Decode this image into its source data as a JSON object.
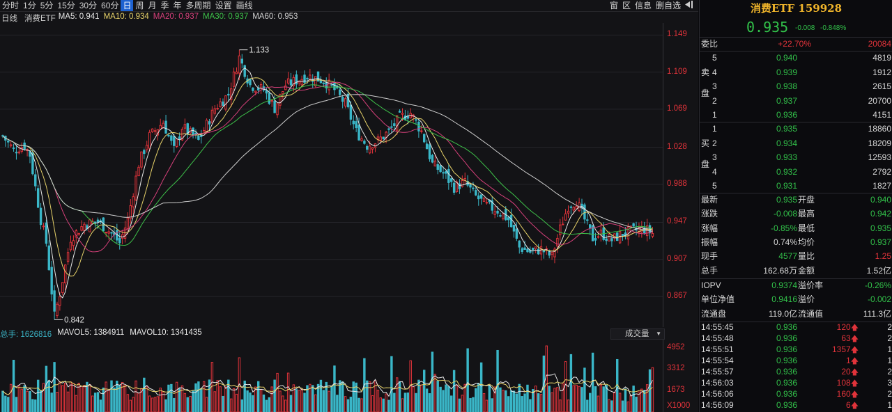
{
  "toolbar": {
    "periods": [
      "分时",
      "1分",
      "5分",
      "15分",
      "30分",
      "60分",
      "日",
      "周",
      "月",
      "季",
      "年",
      "多周期",
      "设置",
      "画线"
    ],
    "active_period": "日",
    "right_buttons": [
      "窗",
      "区",
      "信息",
      "删自选"
    ]
  },
  "ma_legend": {
    "label": "日线",
    "name": "消费ETF",
    "items": [
      {
        "text": "MA5: 0.941",
        "color": "#e8e8e8"
      },
      {
        "text": "MA10: 0.934",
        "color": "#e8d36a"
      },
      {
        "text": "MA20: 0.937",
        "color": "#d6407a"
      },
      {
        "text": "MA30: 0.937",
        "color": "#3ec24a"
      },
      {
        "text": "MA60: 0.953",
        "color": "#cfcfcf"
      }
    ]
  },
  "vol_legend": {
    "items": [
      {
        "text": "总手: 1626816",
        "color": "#3ab0c2"
      },
      {
        "text": "MAVOL5: 1384911",
        "color": "#e8e8e8"
      },
      {
        "text": "MAVOL10: 1341435",
        "color": "#e8e8e8"
      }
    ],
    "select_label": "成交量"
  },
  "chart_data": {
    "type": "candlestick",
    "price_axis": [
      "1.149",
      "1.109",
      "1.069",
      "1.028",
      "0.988",
      "0.947",
      "0.907",
      "0.867"
    ],
    "price_axis_values": [
      1.149,
      1.109,
      1.069,
      1.028,
      0.988,
      0.947,
      0.907,
      0.867
    ],
    "y_range": [
      0.834,
      1.162
    ],
    "high_marker": "1.133",
    "low_marker": "0.842",
    "high_value": 1.133,
    "low_value": 0.842,
    "volume_axis": [
      "4952",
      "3312",
      "1673",
      "X1000"
    ],
    "volume_axis_values": [
      4952,
      3312,
      1673
    ],
    "volume_max": 5600,
    "colors": {
      "up": "#e0333a",
      "down": "#3ab7c8",
      "ma5": "#e8e8e8",
      "ma10": "#e8d36a",
      "ma20": "#d6407a",
      "ma30": "#3ec24a",
      "ma60": "#cfcfcf"
    },
    "anchors": [
      [
        0,
        1.04
      ],
      [
        4,
        1.025
      ],
      [
        8,
        1.03
      ],
      [
        10,
        1.02
      ],
      [
        14,
        0.95
      ],
      [
        16,
        0.925
      ],
      [
        19,
        0.846
      ],
      [
        21,
        0.87
      ],
      [
        25,
        0.93
      ],
      [
        30,
        0.945
      ],
      [
        35,
        0.948
      ],
      [
        40,
        0.935
      ],
      [
        43,
        0.925
      ],
      [
        46,
        0.95
      ],
      [
        50,
        1.01
      ],
      [
        54,
        1.04
      ],
      [
        59,
        1.055
      ],
      [
        63,
        1.025
      ],
      [
        66,
        1.05
      ],
      [
        72,
        1.035
      ],
      [
        78,
        1.07
      ],
      [
        83,
        1.085
      ],
      [
        87,
        1.125
      ],
      [
        91,
        1.095
      ],
      [
        96,
        1.09
      ],
      [
        100,
        1.07
      ],
      [
        104,
        1.095
      ],
      [
        108,
        1.1
      ],
      [
        112,
        1.105
      ],
      [
        118,
        1.1
      ],
      [
        122,
        1.09
      ],
      [
        126,
        1.075
      ],
      [
        130,
        1.045
      ],
      [
        134,
        1.03
      ],
      [
        138,
        1.035
      ],
      [
        142,
        1.045
      ],
      [
        146,
        1.06
      ],
      [
        150,
        1.065
      ],
      [
        154,
        1.045
      ],
      [
        158,
        1.01
      ],
      [
        162,
        1.0
      ],
      [
        166,
        0.985
      ],
      [
        170,
        0.99
      ],
      [
        174,
        0.975
      ],
      [
        178,
        0.965
      ],
      [
        182,
        0.96
      ],
      [
        186,
        0.95
      ],
      [
        190,
        0.92
      ],
      [
        194,
        0.915
      ],
      [
        198,
        0.918
      ],
      [
        202,
        0.91
      ],
      [
        205,
        0.94
      ],
      [
        208,
        0.965
      ],
      [
        211,
        0.97
      ],
      [
        214,
        0.95
      ],
      [
        217,
        0.93
      ],
      [
        220,
        0.935
      ],
      [
        224,
        0.928
      ],
      [
        228,
        0.935
      ],
      [
        232,
        0.938
      ],
      [
        236,
        0.94
      ],
      [
        239,
        0.935
      ]
    ]
  },
  "panel": {
    "title": "消费ETF 159928",
    "price": "0.935",
    "change": "-0.008",
    "change_pct": "-0.848%",
    "weibi": {
      "label": "委比",
      "pct": "+22.70%",
      "diff": "20084"
    },
    "sell_label": [
      "卖",
      "盘"
    ],
    "buy_label": [
      "买",
      "盘"
    ],
    "sell": [
      {
        "level": "5",
        "price": "0.940",
        "vol": "4819"
      },
      {
        "level": "4",
        "price": "0.939",
        "vol": "1912"
      },
      {
        "level": "3",
        "price": "0.938",
        "vol": "2615"
      },
      {
        "level": "2",
        "price": "0.937",
        "vol": "20700"
      },
      {
        "level": "1",
        "price": "0.936",
        "vol": "4151"
      }
    ],
    "buy": [
      {
        "level": "1",
        "price": "0.935",
        "vol": "18860"
      },
      {
        "level": "2",
        "price": "0.934",
        "vol": "18209"
      },
      {
        "level": "3",
        "price": "0.933",
        "vol": "12593"
      },
      {
        "level": "4",
        "price": "0.932",
        "vol": "2792"
      },
      {
        "level": "5",
        "price": "0.931",
        "vol": "1827"
      }
    ],
    "stats": [
      {
        "l1": "最新",
        "v1": "0.935",
        "c1": "green",
        "l2": "开盘",
        "v2": "0.940",
        "c2": "green"
      },
      {
        "l1": "涨跌",
        "v1": "-0.008",
        "c1": "green",
        "l2": "最高",
        "v2": "0.942",
        "c2": "green"
      },
      {
        "l1": "涨幅",
        "v1": "-0.85%",
        "c1": "green",
        "l2": "最低",
        "v2": "0.935",
        "c2": "green"
      },
      {
        "l1": "振幅",
        "v1": "0.74%",
        "c1": "white",
        "l2": "均价",
        "v2": "0.937",
        "c2": "green"
      },
      {
        "l1": "现手",
        "v1": "4577",
        "c1": "green",
        "l2": "量比",
        "v2": "1.25",
        "c2": "red"
      },
      {
        "l1": "总手",
        "v1": "162.68万",
        "c1": "white",
        "l2": "金额",
        "v2": "1.52亿",
        "c2": "white"
      }
    ],
    "iopv": [
      {
        "l1": "IOPV",
        "v1": "0.9374",
        "c1": "green",
        "l2": "溢价率",
        "v2": "-0.26%",
        "c2": "green"
      },
      {
        "l1": "单位净值",
        "v1": "0.9416",
        "c1": "green",
        "l2": "溢价",
        "v2": "-0.002",
        "c2": "green"
      },
      {
        "l1": "流通盘",
        "v1": "119.0亿",
        "c1": "white",
        "l2": "流通值",
        "v2": "111.3亿",
        "c2": "white"
      }
    ],
    "ticks": [
      {
        "time": "14:55:45",
        "price": "0.936",
        "vol": "120",
        "n": "2"
      },
      {
        "time": "14:55:48",
        "price": "0.936",
        "vol": "63",
        "n": "2"
      },
      {
        "time": "14:55:51",
        "price": "0.936",
        "vol": "1357",
        "n": "1"
      },
      {
        "time": "14:55:54",
        "price": "0.936",
        "vol": "1",
        "n": "1"
      },
      {
        "time": "14:55:57",
        "price": "0.936",
        "vol": "20",
        "n": "2"
      },
      {
        "time": "14:56:03",
        "price": "0.936",
        "vol": "108",
        "n": "3"
      },
      {
        "time": "14:56:06",
        "price": "0.936",
        "vol": "160",
        "n": "2"
      },
      {
        "time": "14:56:09",
        "price": "0.936",
        "vol": "6",
        "n": "1"
      }
    ]
  }
}
